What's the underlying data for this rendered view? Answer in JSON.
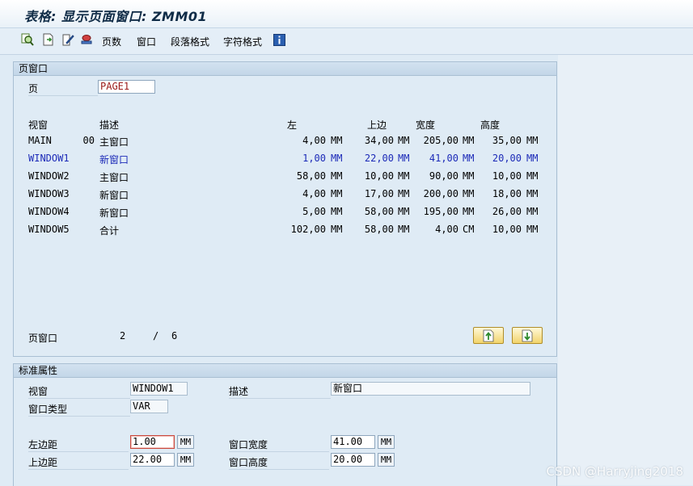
{
  "title": "表格: 显示页面窗口: ZMM01",
  "toolbar": {
    "items": [
      "页数",
      "窗口",
      "段落格式",
      "字符格式"
    ],
    "icons": [
      "search-zoom-icon",
      "forward-doc-icon",
      "edit-pencil-icon",
      "stamp-icon",
      "info-icon"
    ]
  },
  "page_window": {
    "header": "页窗口",
    "page_label": "页",
    "page_value": "PAGE1",
    "columns": {
      "window": "视窗",
      "desc": "描述",
      "left": "左",
      "top": "上边",
      "width": "宽度",
      "height": "高度"
    },
    "rows": [
      {
        "window": "MAIN",
        "code": "00",
        "desc": "主窗口",
        "left": "4,00",
        "lu": "MM",
        "top": "34,00",
        "tu": "MM",
        "width": "205,00",
        "wu": "MM",
        "height": "35,00",
        "hu": "MM",
        "selected": false
      },
      {
        "window": "WINDOW1",
        "code": "",
        "desc": "新窗口",
        "left": "1,00",
        "lu": "MM",
        "top": "22,00",
        "tu": "MM",
        "width": "41,00",
        "wu": "MM",
        "height": "20,00",
        "hu": "MM",
        "selected": true
      },
      {
        "window": "WINDOW2",
        "code": "",
        "desc": "主窗口",
        "left": "58,00",
        "lu": "MM",
        "top": "10,00",
        "tu": "MM",
        "width": "90,00",
        "wu": "MM",
        "height": "10,00",
        "hu": "MM",
        "selected": false
      },
      {
        "window": "WINDOW3",
        "code": "",
        "desc": "新窗口",
        "left": "4,00",
        "lu": "MM",
        "top": "17,00",
        "tu": "MM",
        "width": "200,00",
        "wu": "MM",
        "height": "18,00",
        "hu": "MM",
        "selected": false
      },
      {
        "window": "WINDOW4",
        "code": "",
        "desc": "新窗口",
        "left": "5,00",
        "lu": "MM",
        "top": "58,00",
        "tu": "MM",
        "width": "195,00",
        "wu": "MM",
        "height": "26,00",
        "hu": "MM",
        "selected": false
      },
      {
        "window": "WINDOW5",
        "code": "",
        "desc": "合计",
        "left": "102,00",
        "lu": "MM",
        "top": "58,00",
        "tu": "MM",
        "width": "4,00",
        "wu": "CM",
        "height": "10,00",
        "hu": "MM",
        "selected": false
      }
    ],
    "footer_label": "页窗口",
    "current": "2",
    "separator": "/",
    "total": "6"
  },
  "std_attrs": {
    "header": "标准属性",
    "window_label": "视窗",
    "window_value": "WINDOW1",
    "desc_label": "描述",
    "desc_value": "新窗口",
    "type_label": "窗口类型",
    "type_value": "VAR",
    "left_margin_label": "左边距",
    "left_margin_value": "1.00",
    "left_margin_unit": "MM",
    "top_margin_label": "上边距",
    "top_margin_value": "22.00",
    "top_margin_unit": "MM",
    "width_label": "窗口宽度",
    "width_value": "41.00",
    "width_unit": "MM",
    "height_label": "窗口高度",
    "height_value": "20.00",
    "height_unit": "MM"
  },
  "watermark": "CSDN @Harryjing2018",
  "colors": {
    "selected_row": "#1d2bb8",
    "page_value": "#9b1a1a"
  }
}
